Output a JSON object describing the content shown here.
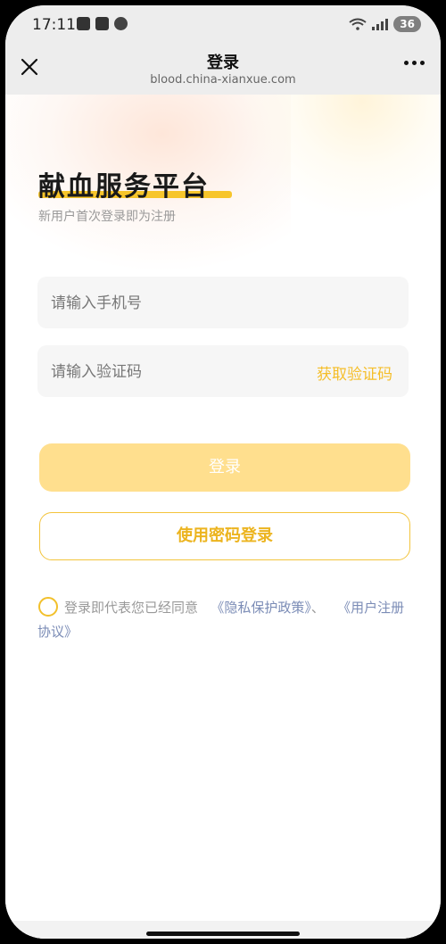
{
  "status_bar": {
    "time": "17:11",
    "battery": "36"
  },
  "nav": {
    "title": "登录",
    "url": "blood.china-xianxue.com"
  },
  "page": {
    "title": "献血服务平台",
    "subtitle": "新用户首次登录即为注册"
  },
  "form": {
    "phone_placeholder": "请输入手机号",
    "code_placeholder": "请输入验证码",
    "get_code_label": "获取验证码"
  },
  "buttons": {
    "login": "登录",
    "password_login": "使用密码登录"
  },
  "agreement": {
    "prefix": "登录即代表您已经同意",
    "privacy": "《隐私保护政策》",
    "sep": "、",
    "terms": "《用户注册协议》"
  },
  "colors": {
    "accent": "#f5be29",
    "login_button": "#ffdf8e",
    "link": "#7b8cb6"
  }
}
